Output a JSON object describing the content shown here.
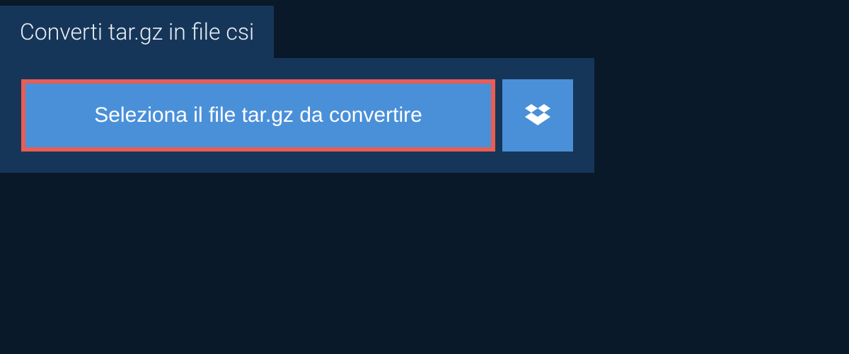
{
  "tab": {
    "title": "Converti tar.gz in file csi"
  },
  "panel": {
    "select_button_label": "Seleziona il file tar.gz da convertire"
  },
  "colors": {
    "background": "#0a1929",
    "panel": "#163659",
    "button": "#4a90d9",
    "highlight_border": "#e85d54"
  }
}
